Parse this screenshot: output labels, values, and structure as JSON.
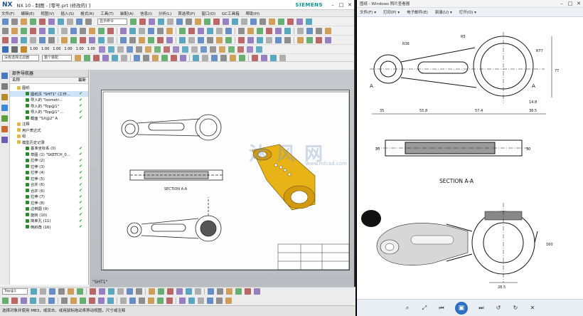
{
  "nx": {
    "logo": "NX",
    "title": "NX 10 - 制图 - [零号.prt  (修改的)  ]",
    "brand": "SIEMENS",
    "menu": [
      "文件(F)",
      "编辑(E)",
      "视图(V)",
      "插入(S)",
      "格式(R)",
      "工具(T)",
      "装配(A)",
      "信息(I)",
      "分析(L)",
      "首选项(P)",
      "窗口(O)",
      "GC工具箱",
      "帮助(H)"
    ],
    "toolbar_field1": "显示命令",
    "toolbar_nums": [
      "1.00",
      "1.00",
      "1.00",
      "1.00",
      "1.00",
      "1.00"
    ],
    "selection_filter": "没有选择过滤器",
    "selection_scope": "整个装配",
    "navigator": {
      "header": "部件导航器",
      "col_name": "名称",
      "col_latest": "最新",
      "rows": [
        {
          "label": "图纸",
          "latest": false
        },
        {
          "label": "图纸页 \"SHT1\" (工作...",
          "latest": true
        },
        {
          "label": "导入的 \"Isometr...",
          "latest": true
        },
        {
          "label": "导入的 \"Top@1\"",
          "latest": true
        },
        {
          "label": "导入的 \"Top@1\" ...",
          "latest": true
        },
        {
          "label": "截面 \"SX@2\" A",
          "latest": true
        },
        {
          "label": "注释",
          "latest": false
        },
        {
          "label": "用户表达式",
          "latest": false
        },
        {
          "label": "组",
          "latest": false
        },
        {
          "label": "模型历史记录",
          "latest": false
        },
        {
          "label": "基准坐标系 (0)",
          "latest": true
        },
        {
          "label": "草图 (1) \"SKETCH_0...",
          "latest": true
        },
        {
          "label": "拉伸 (2)",
          "latest": true
        },
        {
          "label": "拉伸 (3)",
          "latest": true
        },
        {
          "label": "拉伸 (4)",
          "latest": true
        },
        {
          "label": "拉伸 (5)",
          "latest": true
        },
        {
          "label": "合并 (6)",
          "latest": true
        },
        {
          "label": "合并 (6)",
          "latest": true
        },
        {
          "label": "拉伸 (7)",
          "latest": true
        },
        {
          "label": "拉伸 (8)",
          "latest": true
        },
        {
          "label": "边倒圆 (9)",
          "latest": true
        },
        {
          "label": "旋转 (10)",
          "latest": true
        },
        {
          "label": "简单孔 (11)",
          "latest": true
        },
        {
          "label": "倒斜角 (16)",
          "latest": true
        }
      ]
    },
    "sheet_name": "\"SHT1\"",
    "section_label": "SECTION  A-A",
    "bottom_field": "Top@1",
    "status_text": "选择对象并使用 MB3，或双击，或用鼠标拖动来移动视图，尺寸或注释"
  },
  "viewer": {
    "title": "图纸 - Windows 照片查看器",
    "menu": [
      "文件(F) ▾",
      "打印(P) ▾",
      "电子邮件(E)",
      "刻录(U) ▾",
      "打开(O) ▾"
    ],
    "section_label": "SECTION  A-A",
    "dims_top": [
      "35",
      "55.8",
      "57.4",
      "38.5",
      "14.8"
    ],
    "dims_right": [
      "77",
      "55"
    ],
    "label_a": "A",
    "label_sdim": [
      "R36",
      "R77",
      "R5"
    ],
    "dim_bottom": "28.5",
    "dim_side": "160",
    "dims_section_left": [
      "20",
      "7"
    ],
    "dims_section_right": [
      "30",
      "35"
    ]
  },
  "watermark": {
    "text": "沐 风 网",
    "url": "www.mfcad.com"
  }
}
